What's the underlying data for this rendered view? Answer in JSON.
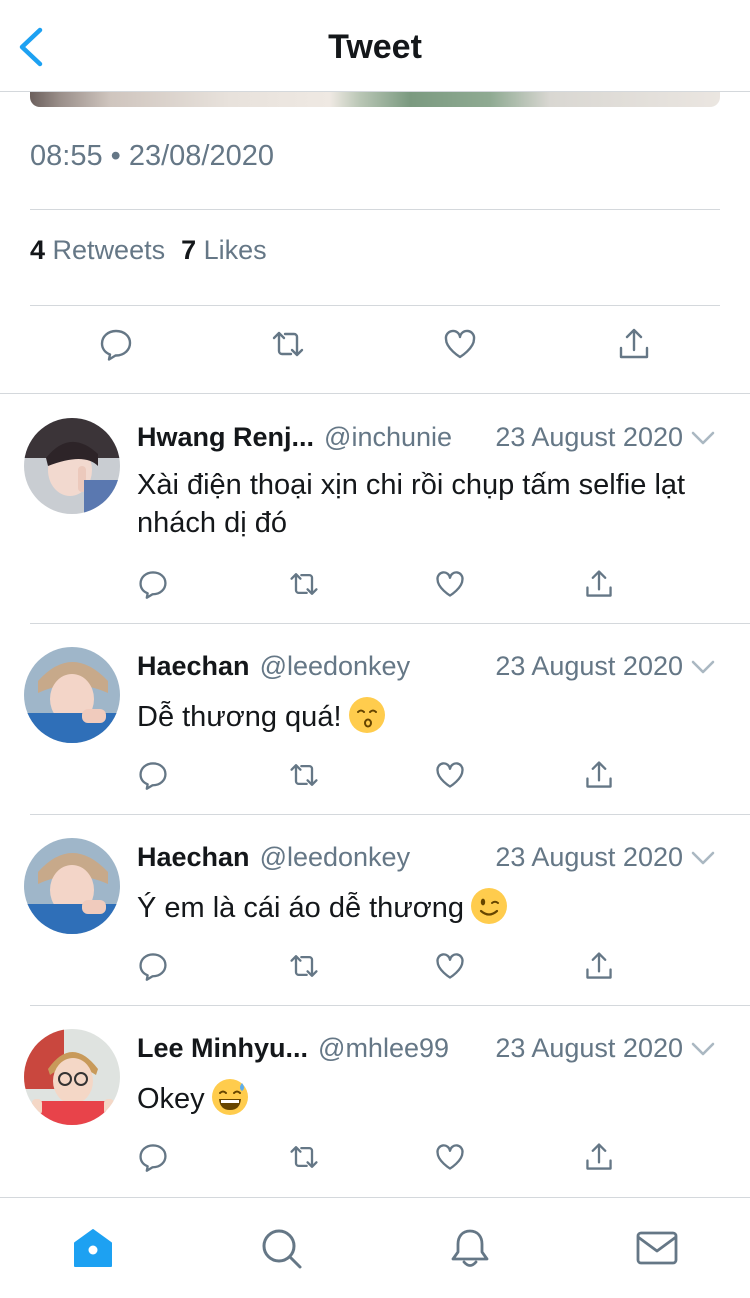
{
  "header": {
    "title": "Tweet"
  },
  "tweet": {
    "timestamp": "08:55 • 23/08/2020",
    "retweet_count": "4",
    "retweet_label": "Retweets",
    "like_count": "7",
    "like_label": "Likes"
  },
  "replies": [
    {
      "name": "Hwang Renj...",
      "handle": "@inchunie",
      "date": "23 August 2020",
      "text": "Xài điện thoại xịn chi rồi chụp tấm selfie lạt nhách dị đó",
      "emoji": ""
    },
    {
      "name": "Haechan",
      "handle": "@leedonkey",
      "date": "23 August 2020",
      "text": "Dễ thương quá!",
      "emoji": "kissing-face"
    },
    {
      "name": "Haechan",
      "handle": "@leedonkey",
      "date": "23 August 2020",
      "text": "Ý em là cái áo dễ thương",
      "emoji": "winking-face"
    },
    {
      "name": "Lee Minhyu...",
      "handle": "@mhlee99",
      "date": "23 August 2020",
      "text": "Okey",
      "emoji": "grinning-sweat-face"
    }
  ],
  "tabbar": {
    "active": "home",
    "items": [
      "home-icon",
      "search-icon",
      "bell-icon",
      "mail-icon"
    ]
  },
  "colors": {
    "accent": "#1da1f2",
    "secondary_text": "#657786",
    "divider": "#d4d8dc",
    "icon": "#657786"
  }
}
